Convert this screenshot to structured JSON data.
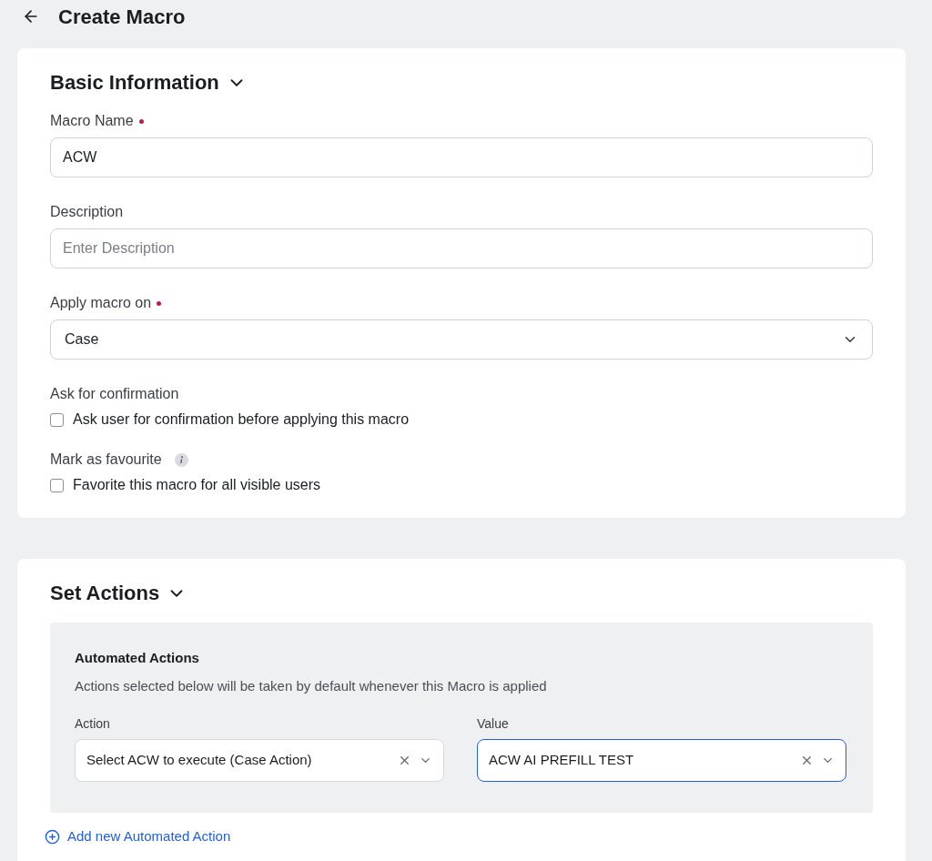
{
  "header": {
    "title": "Create Macro"
  },
  "basic_information": {
    "title": "Basic Information",
    "expanded": true,
    "fields": [
      {
        "kind": "text",
        "label": "Macro Name",
        "required": true,
        "value": "ACW"
      },
      {
        "kind": "text",
        "label": "Description",
        "required": false,
        "placeholder": "Enter Description"
      },
      {
        "kind": "select",
        "label": "Apply macro on",
        "required": true,
        "value": "Case"
      },
      {
        "kind": "checkbox",
        "label": "Ask for confirmation",
        "info": false,
        "option": "Ask user for confirmation before applying this macro",
        "checked": false
      },
      {
        "kind": "checkbox",
        "label": "Mark as favourite",
        "info": true,
        "option": "Favorite this macro for all visible users",
        "checked": false
      }
    ]
  },
  "set_actions": {
    "title": "Set Actions",
    "expanded": true,
    "automated_actions": {
      "title": "Automated Actions",
      "description": "Actions selected below will be taken by default whenever this Macro is applied",
      "columns": [
        {
          "label": "Action",
          "value": "Select ACW to execute (Case Action)",
          "focused": false
        },
        {
          "label": "Value",
          "value": "ACW AI PREFILL TEST",
          "focused": true
        }
      ]
    },
    "add_link": "Add new Automated Action"
  }
}
